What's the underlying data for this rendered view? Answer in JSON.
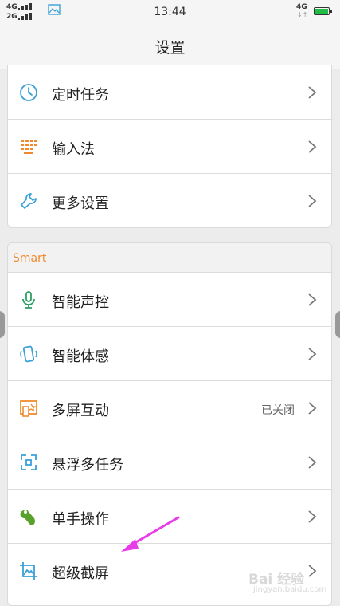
{
  "status_bar": {
    "signal1": "4G",
    "signal2": "2G",
    "time": "13:44",
    "network": "4G",
    "network_arrows": "↓↑",
    "icons": [
      "signal-bars-icon",
      "photo-icon",
      "battery-icon"
    ]
  },
  "header": {
    "title": "设置"
  },
  "group1": {
    "items": [
      {
        "label": "定时任务",
        "icon": "clock-icon"
      },
      {
        "label": "输入法",
        "icon": "keyboard-icon"
      },
      {
        "label": "更多设置",
        "icon": "wrench-icon"
      }
    ]
  },
  "group2": {
    "section_title": "Smart",
    "items": [
      {
        "label": "智能声控",
        "icon": "microphone-icon"
      },
      {
        "label": "智能体感",
        "icon": "motion-phone-icon"
      },
      {
        "label": "多屏互动",
        "icon": "multi-screen-icon",
        "value": "已关闭"
      },
      {
        "label": "悬浮多任务",
        "icon": "floating-task-icon"
      },
      {
        "label": "单手操作",
        "icon": "one-hand-icon"
      },
      {
        "label": "超级截屏",
        "icon": "screenshot-icon"
      }
    ]
  },
  "watermark": {
    "text": "Bai 经验",
    "sub": "jingyan.baidu.com"
  },
  "colors": {
    "accent": "#f08a2c",
    "blue": "#3aa0d8",
    "green": "#2aa060",
    "orange": "#f08a2c"
  }
}
